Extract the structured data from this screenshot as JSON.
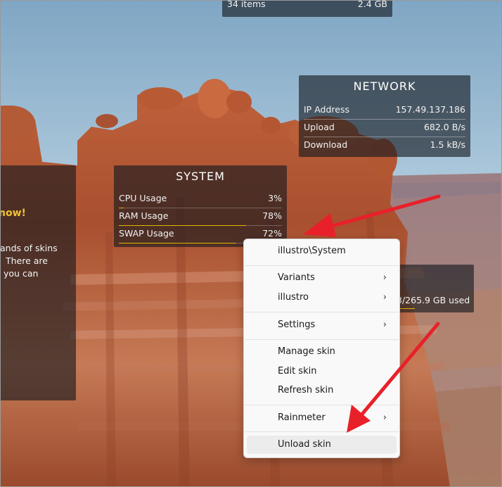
{
  "files_skin": {
    "items": "34 items",
    "size": "2.4 GB"
  },
  "network": {
    "title": "NETWORK",
    "rows": [
      {
        "label": "IP Address",
        "value": "157.49.137.186"
      },
      {
        "label": "Upload",
        "value": "682.0 B/s"
      },
      {
        "label": "Download",
        "value": "1.5 kB/s"
      }
    ]
  },
  "system": {
    "title": "SYSTEM",
    "rows": [
      {
        "label": "CPU Usage",
        "value": "3%",
        "fill": 0.03
      },
      {
        "label": "RAM Usage",
        "value": "78%",
        "fill": 0.78
      },
      {
        "label": "SWAP Usage",
        "value": "72%",
        "fill": 0.72
      }
    ]
  },
  "welcome": {
    "headline": "now!",
    "line1": "ands of skins",
    "line2": "There are",
    "line3": "you can"
  },
  "disk": {
    "used": "3/265.9 GB used"
  },
  "context_menu": {
    "header": "illustro\\System",
    "variants": "Variants",
    "illustro": "illustro",
    "settings": "Settings",
    "manage_skin": "Manage skin",
    "edit_skin": "Edit skin",
    "refresh_skin": "Refresh skin",
    "rainmeter": "Rainmeter",
    "unload_skin": "Unload skin",
    "submenu_icon": "chevron-right-icon"
  },
  "colors": {
    "accent_bar": "#e3b400",
    "arrow": "#e8202a",
    "menu_bg": "#f9f9f9"
  }
}
